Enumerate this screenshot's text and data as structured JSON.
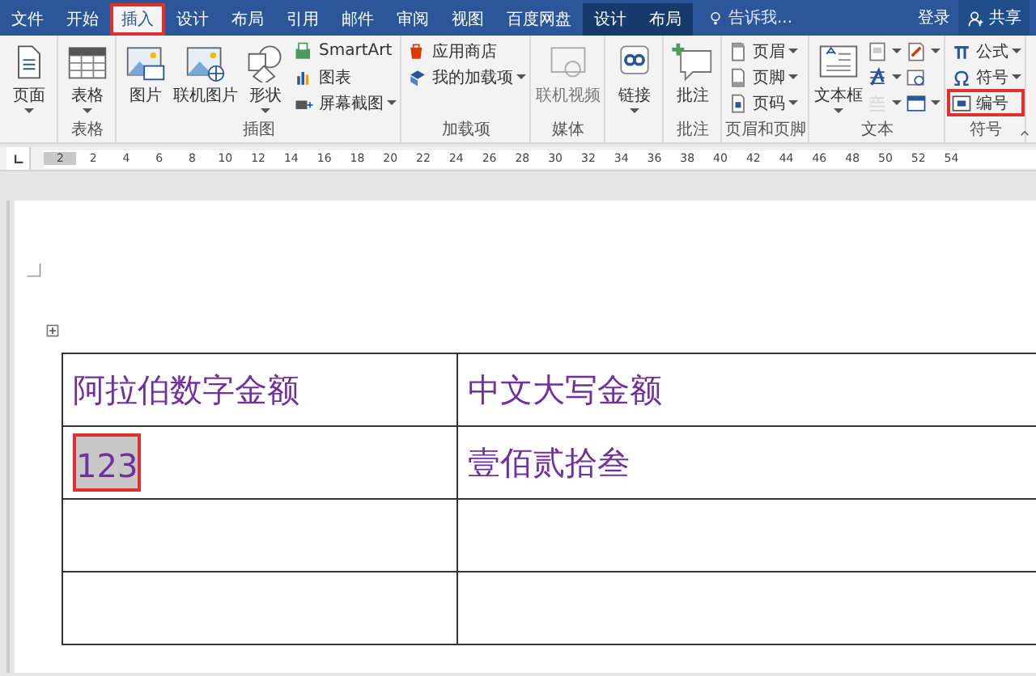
{
  "menu_tabs": [
    {
      "label": "文件",
      "selected": false,
      "contextual": false
    },
    {
      "label": "开始",
      "selected": false,
      "contextual": false
    },
    {
      "label": "插入",
      "selected": true,
      "contextual": false
    },
    {
      "label": "设计",
      "selected": false,
      "contextual": false
    },
    {
      "label": "布局",
      "selected": false,
      "contextual": false
    },
    {
      "label": "引用",
      "selected": false,
      "contextual": false
    },
    {
      "label": "邮件",
      "selected": false,
      "contextual": false
    },
    {
      "label": "审阅",
      "selected": false,
      "contextual": false
    },
    {
      "label": "视图",
      "selected": false,
      "contextual": false
    },
    {
      "label": "百度网盘",
      "selected": false,
      "contextual": false
    },
    {
      "label": "设计",
      "selected": false,
      "contextual": true
    },
    {
      "label": "布局",
      "selected": false,
      "contextual": true
    }
  ],
  "tell_me": {
    "placeholder": "告诉我..."
  },
  "sign_in": "登录",
  "share": "共享",
  "ribbon_groups": [
    {
      "items": [
        {
          "kind": "large",
          "label": "页面",
          "dropdown": true,
          "disabled": false,
          "highlighted": false
        }
      ]
    },
    {
      "label": "表格",
      "items": [
        {
          "kind": "large",
          "label": "表格",
          "dropdown": true,
          "disabled": false,
          "highlighted": false
        }
      ]
    },
    {
      "label": "插图",
      "items": [
        {
          "kind": "large",
          "label": "图片",
          "dropdown": false,
          "disabled": false,
          "highlighted": false
        },
        {
          "kind": "large",
          "label": "联机图片",
          "dropdown": false,
          "disabled": false,
          "highlighted": false
        },
        {
          "kind": "large",
          "label": "形状",
          "dropdown": true,
          "disabled": false,
          "highlighted": false
        },
        {
          "kind": "small",
          "label": "SmartArt",
          "dropdown": false,
          "disabled": false,
          "highlighted": false
        },
        {
          "kind": "small",
          "label": "图表",
          "dropdown": false,
          "disabled": false,
          "highlighted": false
        },
        {
          "kind": "small",
          "label": "屏幕截图",
          "dropdown": true,
          "disabled": false,
          "highlighted": false
        }
      ]
    },
    {
      "label": "加载项",
      "items": [
        {
          "kind": "small",
          "label": "应用商店",
          "dropdown": false,
          "disabled": false,
          "highlighted": false
        },
        {
          "kind": "small",
          "label": "我的加载项",
          "dropdown": true,
          "disabled": false,
          "highlighted": false
        }
      ]
    },
    {
      "label": "媒体",
      "items": [
        {
          "kind": "large",
          "label": "联机视频",
          "dropdown": false,
          "disabled": true,
          "highlighted": false
        }
      ]
    },
    {
      "items": [
        {
          "kind": "large",
          "label": "链接",
          "dropdown": true,
          "disabled": false,
          "highlighted": false
        }
      ]
    },
    {
      "label": "批注",
      "items": [
        {
          "kind": "large",
          "label": "批注",
          "dropdown": false,
          "disabled": false,
          "highlighted": false
        }
      ]
    },
    {
      "label": "页眉和页脚",
      "items": [
        {
          "kind": "small",
          "label": "页眉",
          "dropdown": true,
          "disabled": false,
          "highlighted": false
        },
        {
          "kind": "small",
          "label": "页脚",
          "dropdown": true,
          "disabled": false,
          "highlighted": false
        },
        {
          "kind": "small",
          "label": "页码",
          "dropdown": true,
          "disabled": false,
          "highlighted": false
        }
      ]
    },
    {
      "label": "文本",
      "items": [
        {
          "kind": "large",
          "label": "文本框",
          "dropdown": true,
          "disabled": false,
          "highlighted": false
        },
        {
          "kind": "icon",
          "dropdown": true,
          "disabled": false,
          "highlighted": false
        },
        {
          "kind": "icon",
          "dropdown": true,
          "disabled": false,
          "highlighted": false
        },
        {
          "kind": "icon",
          "dropdown": true,
          "disabled": true,
          "highlighted": false
        },
        {
          "kind": "icon",
          "dropdown": true,
          "disabled": false,
          "highlighted": false
        },
        {
          "kind": "icon",
          "dropdown": false,
          "disabled": false,
          "highlighted": false
        },
        {
          "kind": "icon",
          "dropdown": true,
          "disabled": false,
          "highlighted": false
        }
      ]
    },
    {
      "label": "符号",
      "items": [
        {
          "kind": "small",
          "label": "公式",
          "dropdown": true,
          "disabled": false,
          "highlighted": false
        },
        {
          "kind": "small",
          "label": "符号",
          "dropdown": true,
          "disabled": false,
          "highlighted": false
        },
        {
          "kind": "small",
          "label": "编号",
          "dropdown": false,
          "disabled": false,
          "highlighted": true
        }
      ]
    }
  ],
  "ruler": [
    "2",
    "2",
    "4",
    "6",
    "8",
    "10",
    "12",
    "14",
    "16",
    "18",
    "20",
    "22",
    "24",
    "26",
    "28",
    "30",
    "32",
    "34",
    "36",
    "38",
    "40",
    "42",
    "44",
    "46",
    "48",
    "50",
    "52",
    "54"
  ],
  "table": {
    "rows": [
      [
        {
          "text": "阿拉伯数字金额",
          "selected": false
        },
        {
          "text": "中文大写金额",
          "selected": false
        }
      ],
      [
        {
          "text": "123",
          "selected": true
        },
        {
          "text": "壹佰贰拾叁",
          "selected": false
        }
      ],
      [
        {
          "text": "",
          "selected": false
        },
        {
          "text": "",
          "selected": false
        }
      ],
      [
        {
          "text": "",
          "selected": false
        },
        {
          "text": "",
          "selected": false
        }
      ]
    ]
  }
}
